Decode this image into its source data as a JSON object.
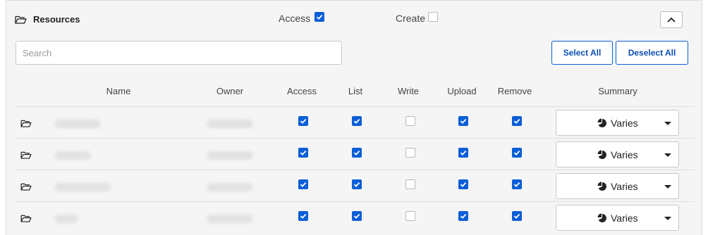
{
  "header": {
    "title": "Resources",
    "access_label": "Access",
    "access_checked": true,
    "create_label": "Create",
    "create_checked": false
  },
  "search": {
    "placeholder": "Search",
    "value": ""
  },
  "buttons": {
    "select_all": "Select All",
    "deselect_all": "Deselect All"
  },
  "table": {
    "columns": [
      "Name",
      "Owner",
      "Access",
      "List",
      "Write",
      "Upload",
      "Remove",
      "Summary"
    ],
    "rows": [
      {
        "access": true,
        "list": true,
        "write": false,
        "upload": true,
        "remove": true,
        "summary": "Varies"
      },
      {
        "access": true,
        "list": true,
        "write": false,
        "upload": true,
        "remove": true,
        "summary": "Varies"
      },
      {
        "access": true,
        "list": true,
        "write": false,
        "upload": true,
        "remove": true,
        "summary": "Varies"
      },
      {
        "access": true,
        "list": true,
        "write": false,
        "upload": true,
        "remove": true,
        "summary": "Varies"
      }
    ]
  },
  "colors": {
    "accent": "#0b5ed7",
    "panel_bg": "#f5f5f5",
    "border": "#dedede"
  },
  "icons": {
    "folder": "folder-open-icon",
    "collapse": "chevron-up-icon",
    "summary": "pie-chart-icon",
    "dropdown": "caret-down-icon"
  }
}
